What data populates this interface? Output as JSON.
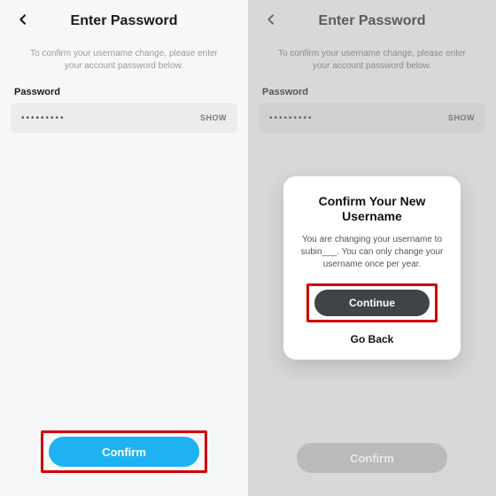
{
  "left": {
    "header": {
      "title": "Enter Password"
    },
    "instruction": "To confirm your username change, please enter your account password below.",
    "passwordLabel": "Password",
    "passwordMasked": "•••••••••",
    "showLabel": "SHOW",
    "confirmLabel": "Confirm"
  },
  "right": {
    "header": {
      "title": "Enter Password"
    },
    "instruction": "To confirm your username change, please enter your account password below.",
    "passwordLabel": "Password",
    "passwordMasked": "•••••••••",
    "showLabel": "SHOW",
    "confirmLabel": "Confirm",
    "modal": {
      "title": "Confirm Your New Username",
      "body": "You are changing your username to subin___. You can only change your username once per year.",
      "continueLabel": "Continue",
      "goBackLabel": "Go Back"
    }
  }
}
